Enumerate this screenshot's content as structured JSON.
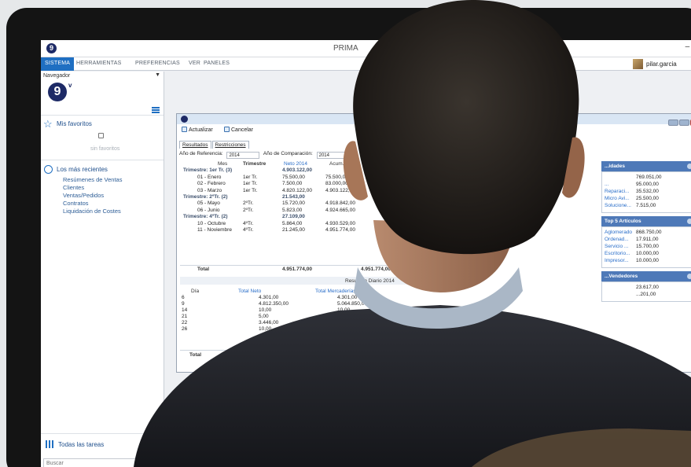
{
  "window": {
    "title": "PRIMA",
    "buttons": "–  □"
  },
  "menu": {
    "items": [
      "SISTEMA",
      "HERRAMIENTAS",
      "PREFERENCIAS",
      "VER",
      "PANELES"
    ],
    "user": "pilar.garcia"
  },
  "navigator": {
    "title": "Navegador",
    "pin": "▼",
    "logo": "9",
    "logo_sup": "v",
    "favorites_title": "Mis favoritos",
    "favorites_empty": "sin favoritos",
    "recent_title": "Los más recientes",
    "recent_items": [
      "Resúmenes de Ventas",
      "Clientes",
      "Ventas/Pedidos",
      "Contratos",
      "Liquidación de Costes"
    ],
    "tasks_label": "Todas las tareas",
    "search_placeholder": "Buscar"
  },
  "inner": {
    "toolbar": {
      "refresh": "Actualizar",
      "cancel": "Cancelar"
    },
    "tabs": [
      "Resultados",
      "Restricciones"
    ],
    "params": {
      "ref_label": "Año de Referencia:",
      "ref_value": "2014",
      "cmp_label": "Año de Comparación:",
      "cmp_value": "2014"
    },
    "grid_header": {
      "mes": "Mes",
      "trimestre": "Trimestre",
      "neto": "Neto 2014",
      "acum": "Acum. Net."
    },
    "rows": [
      {
        "type": "group",
        "c1": "Trimestre: 1er Tr. (3)",
        "c3": "4.903.122,00"
      },
      {
        "type": "item",
        "c1": "01 - Enero",
        "c2": "1er Tr.",
        "c3": "75.500,00",
        "c4": "75.500,00"
      },
      {
        "type": "item",
        "c1": "02 - Febrero",
        "c2": "1er Tr.",
        "c3": "7.500,00",
        "c4": "83.000,00"
      },
      {
        "type": "item",
        "c1": "03 - Marzo",
        "c2": "1er Tr.",
        "c3": "4.820.122,00",
        "c4": "4.903.122,00"
      },
      {
        "type": "group",
        "c1": "Trimestre: 2ºTr. (2)",
        "c3": "21.543,00"
      },
      {
        "type": "item",
        "c1": "05 - Mayo",
        "c2": "2ºTr.",
        "c3": "15.720,00",
        "c4": "4.918.842,00"
      },
      {
        "type": "item",
        "c1": "06 - Junio",
        "c2": "2ºTr.",
        "c3": "5.823,00",
        "c4": "4.924.665,00"
      },
      {
        "type": "group",
        "c1": "Trimestre: 4ºTr. (2)",
        "c3": "27.109,00"
      },
      {
        "type": "item",
        "c1": "10 - Octubre",
        "c2": "4ºTr.",
        "c3": "5.864,00",
        "c4": "4.930.529,00"
      },
      {
        "type": "item",
        "c1": "11 - Noviembre",
        "c2": "4ºTr.",
        "c3": "21.245,00",
        "c4": "4.951.774,00"
      }
    ],
    "total": {
      "label": "Total",
      "c3": "4.951.774,00",
      "c4": "4.951.774,00"
    },
    "resumen": "Resumen Diario 2014",
    "grid2_header": {
      "dia": "Día",
      "neto": "Total Neto",
      "merc": "Total Mercaderías"
    },
    "rows2": [
      {
        "dia": "6",
        "neto": "4.301,00",
        "merc": "4.301,00"
      },
      {
        "dia": "9",
        "neto": "4.812.350,00",
        "merc": "5.064.850,00"
      },
      {
        "dia": "14",
        "neto": "10,00",
        "merc": "10,00"
      },
      {
        "dia": "21",
        "neto": "5,00",
        "merc": "5,00"
      },
      {
        "dia": "22",
        "neto": "3.446,00",
        "merc": "3.620,00"
      },
      {
        "dia": "26",
        "neto": "10,00",
        "merc": "10,00"
      }
    ],
    "total2": {
      "label": "Total",
      "neto": "4.820.122,00"
    }
  },
  "dashboard": {
    "panels": [
      {
        "title": "...idades",
        "rows": [
          [
            "",
            "769.051,00"
          ],
          [
            "...",
            "95.000,00"
          ],
          [
            "Reparaci...",
            "35.532,00"
          ],
          [
            "Micro Avi...",
            "25.500,00"
          ],
          [
            "Solucione...",
            "7.515,00"
          ]
        ]
      },
      {
        "title": "Top 5 Artículos",
        "rows": [
          [
            "Aglomerado",
            "868.750,00"
          ],
          [
            "Ordenad...",
            "17.911,00"
          ],
          [
            "Servicio ...",
            "15.700,00"
          ],
          [
            "Escritorio...",
            "10.000,00"
          ],
          [
            "Impresor...",
            "10.000,00"
          ]
        ]
      },
      {
        "title": "...Vendedores",
        "rows": [
          [
            "",
            "23.617,00"
          ],
          [
            "",
            "...201,00"
          ]
        ]
      }
    ]
  }
}
